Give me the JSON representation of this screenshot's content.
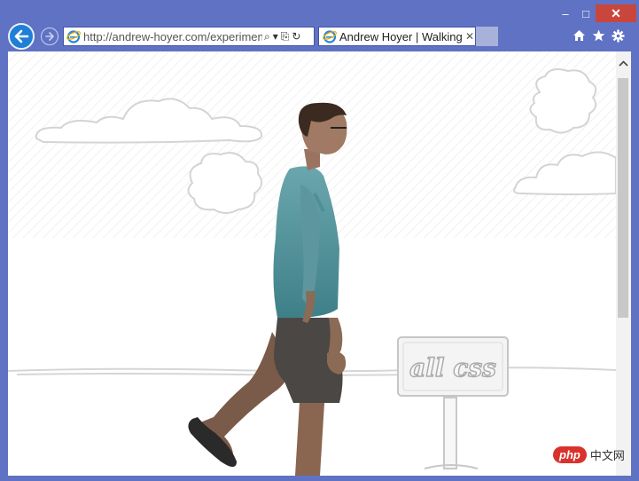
{
  "window": {
    "minimize_label": "–",
    "maximize_label": "□",
    "close_label": "✕"
  },
  "addressbar": {
    "url": "http://andrew-hoyer.com/experiments",
    "search_glyph": "⌕",
    "dropdown_glyph": "▾",
    "compat_glyph": "⎘",
    "refresh_glyph": "↻"
  },
  "tab": {
    "title": "Andrew Hoyer | Walking ...",
    "close_glyph": "✕"
  },
  "page": {
    "sign_text": "all css"
  },
  "watermark": {
    "pill": "php",
    "text": "中文网"
  }
}
